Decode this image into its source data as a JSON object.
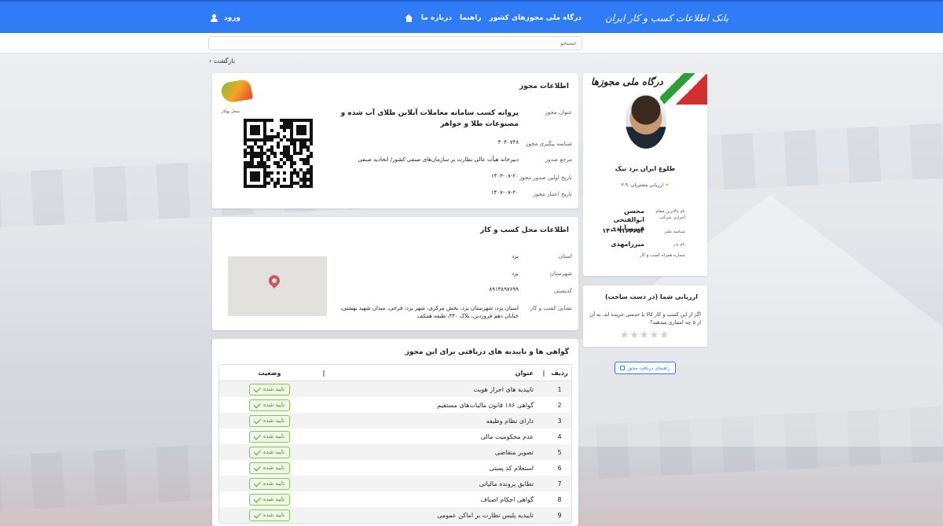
{
  "header": {
    "brand": "بانک اطلاعات کسب و کار ایران",
    "nav": [
      "درباره ما",
      "راهنما",
      "درگاه ملی مجوزهای کشور"
    ],
    "login": "ورود"
  },
  "search": {
    "placeholder": "جستجو"
  },
  "back_label": "بازگشت",
  "permit": {
    "section_title": "اطلاعات مجوز",
    "fields": [
      {
        "label": "عنوان مجوز",
        "value": "پروانه کسب سامانه معاملات آنلاین طلای آب شده و مصنوعات طلا و جواهر"
      },
      {
        "label": "شناسه پیگیری مجوز",
        "value": "۳۰۴۰۷۴۸"
      },
      {
        "label": "مرجع صدور",
        "value": "دبیرخانه هیأت عالی نظارت بر سازمان‌های صنفی کشور/ اتحادیه صنفی"
      },
      {
        "label": "تاریخ اولین صدور مجوز",
        "value": "۱۴۰۳-۰۷-۲۰"
      },
      {
        "label": "تاریخ اعتبار مجوز",
        "value": "۱۴۰۷-۰۷-۲۰"
      }
    ],
    "logo_text": "سجل بهکار"
  },
  "place": {
    "section_title": "اطلاعات محل کسب و کار",
    "fields": [
      {
        "label": "استان",
        "value": "یزد"
      },
      {
        "label": "شهرستان",
        "value": "یزد"
      },
      {
        "label": "کدپستی",
        "value": "۸۹۱۳۸۹۷۶۹۹"
      },
      {
        "label": "نشانی کسب و کار",
        "value": "استان یزد، شهرستان یزد، بخش مرکزی، شهر یزد، فرخی، میدان شهید بهشتی، خیابان دهم فروردین، پلاک ۳۴۰، طبقه همکف"
      }
    ]
  },
  "certs": {
    "section_title": "گواهی ها و تاییدیه های دریافتی برای این مجوز",
    "headers": {
      "idx": "ردیف",
      "title": "عنوان",
      "sep": "|",
      "status": "وضعیت"
    },
    "rows": [
      {
        "idx": "1",
        "title": "تاییدیه های احراز هویت",
        "status": "تایید شده"
      },
      {
        "idx": "2",
        "title": "گواهی ۱۸۶ قانون مالیات‌های مستقیم",
        "status": "تایید شده"
      },
      {
        "idx": "3",
        "title": "دارای نظام وظیفه",
        "status": "تایید شده"
      },
      {
        "idx": "4",
        "title": "عدم محکومیت مالی",
        "status": "تایید شده"
      },
      {
        "idx": "5",
        "title": "تصویر متقاضی",
        "status": "تایید شده"
      },
      {
        "idx": "6",
        "title": "استعلام کد پستی",
        "status": "تایید شده"
      },
      {
        "idx": "7",
        "title": "تطابق پرونده مالیاتی",
        "status": "تایید شده"
      },
      {
        "idx": "8",
        "title": "گواهی احکام اصناف",
        "status": "تایید شده"
      },
      {
        "idx": "9",
        "title": "تاییدیه پلیس نظارت بر اماکن عمومی",
        "status": "تایید شده"
      }
    ]
  },
  "profile": {
    "portal_sign": "درگاه ملی مجوزها",
    "name": "طلوع ایران یزد نیک",
    "rating_text": "ارزیابی مشتریان: ۳.۹",
    "fields": [
      {
        "label": "نام بالاترین مقام اجرایی شرکت",
        "value": "محسن ابوالفتحی فیروزآبادی"
      },
      {
        "label": "شناسه ملی",
        "value": "۱۴۰۰۹۱۶۲۶۵۴"
      },
      {
        "label": "نام پدر",
        "value": "میرزامهدی"
      },
      {
        "label": "شماره همراه کسب و کار",
        "value": ""
      }
    ]
  },
  "rate": {
    "title": "ارزیابی شما (در دست ساخت)",
    "question": "اگر از این کسب و کار کالا یا خدمتی خریده اید، به آن از ۵ چه امتیازی میدهید؟",
    "stars": "★★★★★"
  },
  "guide_button": "راهنمای دریافت مجوز",
  "colors": {
    "primary": "#2f7cf6",
    "success": "#5a9e2c",
    "pin": "#c45b60"
  }
}
